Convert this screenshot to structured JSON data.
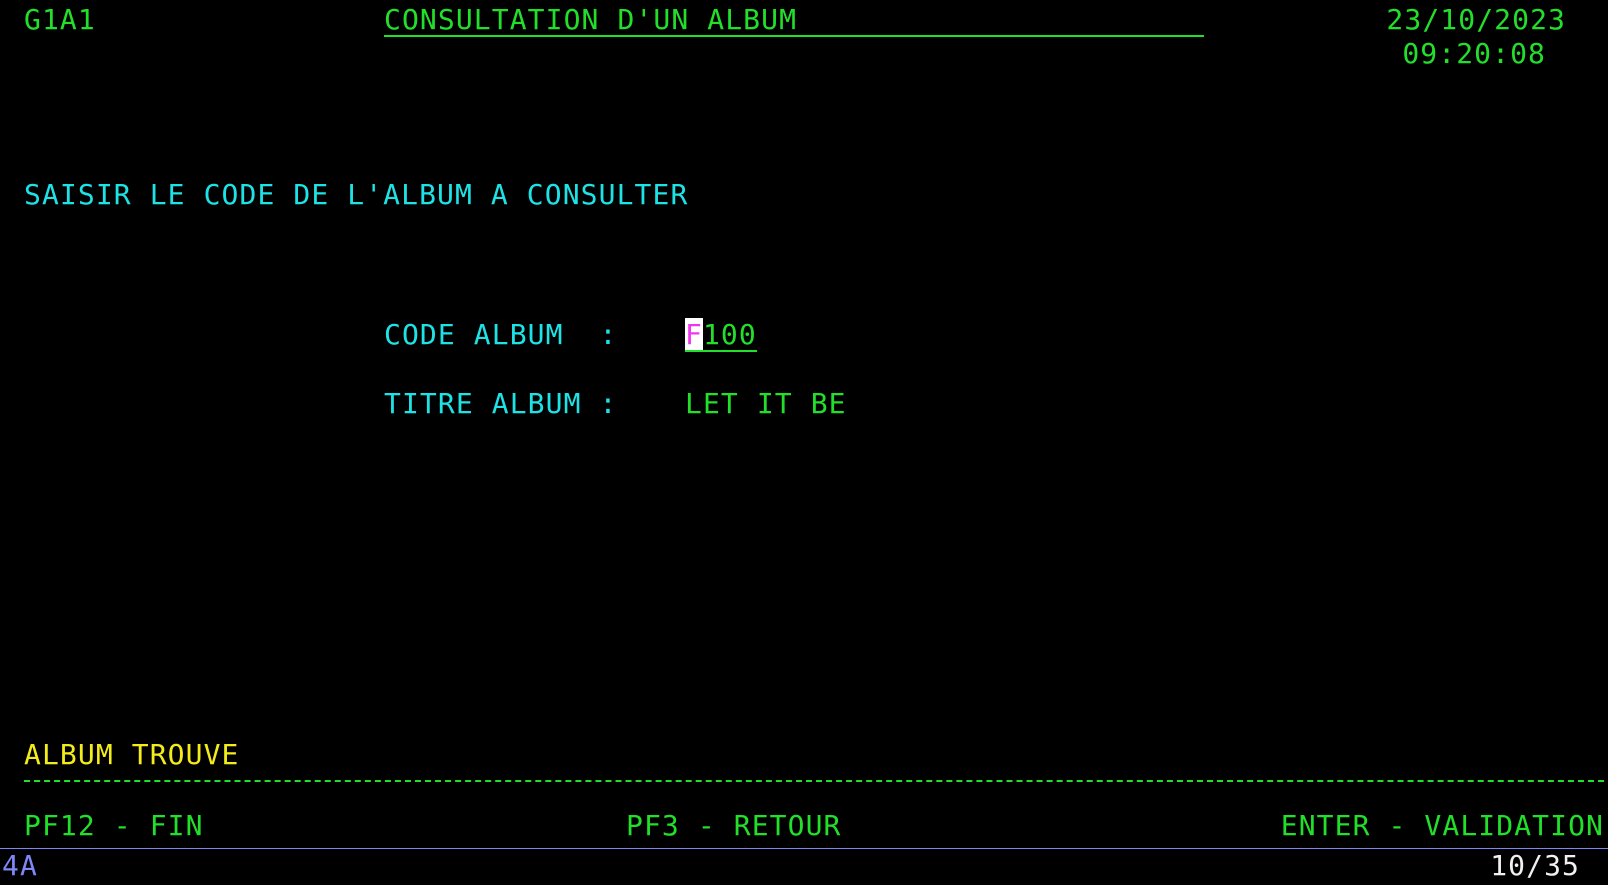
{
  "header": {
    "screen_id": "G1A1",
    "title": "CONSULTATION D'UN ALBUM",
    "date": "23/10/2023",
    "time": "09:20:08"
  },
  "instruction": "SAISIR LE CODE DE L'ALBUM A CONSULTER",
  "form": {
    "code_label": "CODE ALBUM  :",
    "code_value_first": "F",
    "code_value_rest": "100",
    "title_label": "TITRE ALBUM :",
    "title_value": "LET IT BE"
  },
  "message": "ALBUM TROUVE",
  "function_keys": {
    "pf12": "PF12 - FIN",
    "pf3": "PF3 - RETOUR",
    "enter": "ENTER - VALIDATION"
  },
  "status_bar": {
    "left": "4A",
    "right": "10/35"
  },
  "colors": {
    "background": "#000000",
    "field_text": "#22e02a",
    "label_text": "#1ee3e6",
    "message_text": "#f4ec1a",
    "cursor": "#f035f0",
    "status_bar": "#7f86f5"
  }
}
